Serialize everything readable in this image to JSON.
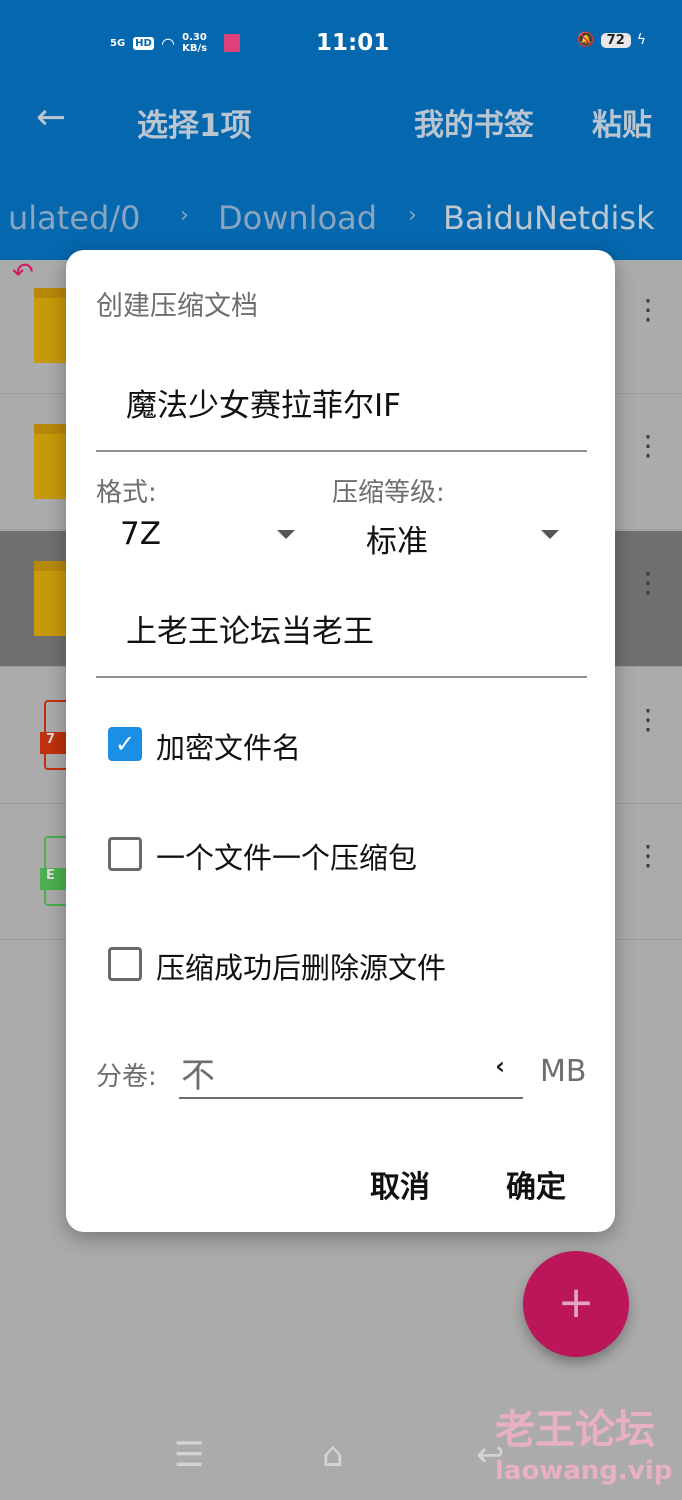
{
  "status_bar": {
    "network": "5G",
    "hd": "HD",
    "speed": "0.30 KB/s",
    "time": "11:01",
    "battery": "72"
  },
  "app_bar": {
    "title": "选择1项",
    "bookmarks": "我的书签",
    "paste": "粘贴"
  },
  "breadcrumbs": [
    "ulated/0",
    "Download",
    "BaiduNetdisk"
  ],
  "file_list": {
    "rows": [
      {
        "type": "folder"
      },
      {
        "type": "folder"
      },
      {
        "type": "folder",
        "selected": true
      },
      {
        "type": "file",
        "tag": "7",
        "color": "#c0300c"
      },
      {
        "type": "file",
        "tag": "E",
        "color": "#4caf50"
      }
    ]
  },
  "dialog": {
    "title": "创建压缩文档",
    "archive_name": "魔法少女赛拉菲尔IF",
    "format_label": "格式:",
    "format_value": "7Z",
    "level_label": "压缩等级:",
    "level_value": "标准",
    "password": "上老王论坛当老王",
    "checkboxes": [
      {
        "label": "加密文件名",
        "checked": true
      },
      {
        "label": "一个文件一个压缩包",
        "checked": false
      },
      {
        "label": "压缩成功后删除源文件",
        "checked": false
      }
    ],
    "split_label": "分卷:",
    "split_value": "不",
    "split_unit": "MB",
    "cancel": "取消",
    "ok": "确定"
  },
  "fab": "+",
  "watermark": {
    "text": "老王论坛",
    "url": "laowang.vip"
  },
  "colors": {
    "appbar": "#0567ad",
    "accent": "#1a8fe3",
    "fab": "#bb1659"
  }
}
